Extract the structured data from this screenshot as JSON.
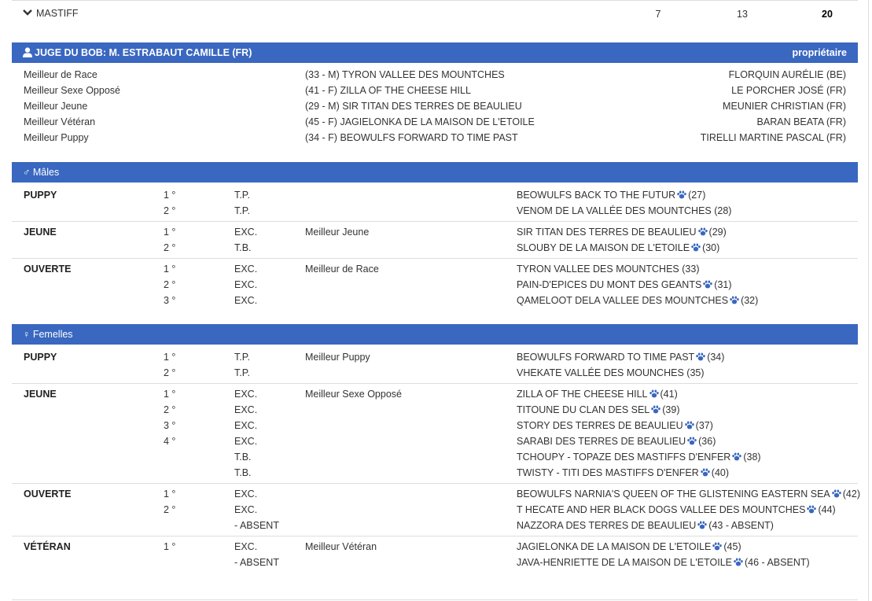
{
  "breed": {
    "name": "MASTIFF",
    "count_a": "7",
    "count_b": "13",
    "total": "20"
  },
  "judge_bar": {
    "title": "JUGE DU BOB: M. ESTRABAUT CAMILLE (FR)",
    "right": "propriétaire",
    "icon": "user-icon"
  },
  "best": [
    {
      "label": "Meilleur de Race",
      "dog": "(33 - M) TYRON VALLEE DES MOUNTCHES",
      "owner": "FLORQUIN AURÉLIE (BE)"
    },
    {
      "label": "Meilleur Sexe Opposé",
      "dog": "(41 - F) ZILLA OF THE CHEESE HILL",
      "owner": "LE PORCHER JOSÉ (FR)"
    },
    {
      "label": "Meilleur Jeune",
      "dog": "(29 - M) SIR TITAN DES TERRES DE BEAULIEU",
      "owner": "MEUNIER CHRISTIAN (FR)"
    },
    {
      "label": "Meilleur Vétéran",
      "dog": "(45 - F) JAGIELONKA DE LA MAISON DE L'ETOILE",
      "owner": "BARAN BEATA (FR)"
    },
    {
      "label": "Meilleur Puppy",
      "dog": "(34 - F) BEOWULFS FORWARD TO TIME PAST",
      "owner": "TIRELLI MARTINE PASCAL (FR)"
    }
  ],
  "males": {
    "title": "♂ Mâles",
    "groups": [
      {
        "cls": "PUPPY",
        "rows": [
          {
            "rank": "1 °",
            "qual": "T.P.",
            "award": "",
            "dog": "BEOWULFS BACK TO THE FUTUR",
            "paw": true,
            "num": "(27)"
          },
          {
            "rank": "2 °",
            "qual": "T.P.",
            "award": "",
            "dog": "VENOM DE LA VALLÉE DES MOUNTCHES",
            "paw": false,
            "num": "(28)"
          }
        ]
      },
      {
        "cls": "JEUNE",
        "rows": [
          {
            "rank": "1 °",
            "qual": "EXC.",
            "award": "Meilleur Jeune",
            "dog": "SIR TITAN DES TERRES DE BEAULIEU",
            "paw": true,
            "num": "(29)"
          },
          {
            "rank": "2 °",
            "qual": "T.B.",
            "award": "",
            "dog": "SLOUBY DE LA MAISON DE L'ETOILE",
            "paw": true,
            "num": "(30)"
          }
        ]
      },
      {
        "cls": "OUVERTE",
        "rows": [
          {
            "rank": "1 °",
            "qual": "EXC.",
            "award": "Meilleur de Race",
            "dog": "TYRON VALLEE DES MOUNTCHES",
            "paw": false,
            "num": "(33)"
          },
          {
            "rank": "2 °",
            "qual": "EXC.",
            "award": "",
            "dog": "PAIN-D'EPICES DU MONT DES GEANTS",
            "paw": true,
            "num": "(31)"
          },
          {
            "rank": "3 °",
            "qual": "EXC.",
            "award": "",
            "dog": "QAMELOOT DELA VALLEE DES MOUNTCHES",
            "paw": true,
            "num": "(32)"
          }
        ]
      }
    ]
  },
  "females": {
    "title": "♀ Femelles",
    "groups": [
      {
        "cls": "PUPPY",
        "rows": [
          {
            "rank": "1 °",
            "qual": "T.P.",
            "award": "Meilleur Puppy",
            "dog": "BEOWULFS FORWARD TO TIME PAST",
            "paw": true,
            "num": "(34)"
          },
          {
            "rank": "2 °",
            "qual": "T.P.",
            "award": "",
            "dog": "VHEKATE VALLÉE DES MOUNCHES",
            "paw": false,
            "num": "(35)"
          }
        ]
      },
      {
        "cls": "JEUNE",
        "rows": [
          {
            "rank": "1 °",
            "qual": "EXC.",
            "award": "Meilleur Sexe Opposé",
            "dog": "ZILLA OF THE CHEESE HILL",
            "paw": true,
            "num": "(41)"
          },
          {
            "rank": "2 °",
            "qual": "EXC.",
            "award": "",
            "dog": "TITOUNE DU CLAN DES SEL",
            "paw": true,
            "num": "(39)"
          },
          {
            "rank": "3 °",
            "qual": "EXC.",
            "award": "",
            "dog": "STORY DES TERRES DE BEAULIEU",
            "paw": true,
            "num": "(37)"
          },
          {
            "rank": "4 °",
            "qual": "EXC.",
            "award": "",
            "dog": "SARABI DES TERRES DE BEAULIEU",
            "paw": true,
            "num": "(36)"
          },
          {
            "rank": "",
            "qual": "T.B.",
            "award": "",
            "dog": "TCHOUPY - TOPAZE DES MASTIFFS D'ENFER",
            "paw": true,
            "num": "(38)"
          },
          {
            "rank": "",
            "qual": "T.B.",
            "award": "",
            "dog": "TWISTY - TITI DES MASTIFFS D'ENFER",
            "paw": true,
            "num": "(40)"
          }
        ]
      },
      {
        "cls": "OUVERTE",
        "rows": [
          {
            "rank": "1 °",
            "qual": "EXC.",
            "award": "",
            "dog": "BEOWULFS NARNIA'S QUEEN OF THE GLISTENING EASTERN SEA",
            "paw": true,
            "num": "(42)"
          },
          {
            "rank": "2 °",
            "qual": "EXC.",
            "award": "",
            "dog": "T HECATE AND HER BLACK DOGS VALLEE DES MOUNTCHES",
            "paw": true,
            "num": "(44)"
          },
          {
            "rank": "",
            "qual": "- ABSENT",
            "award": "",
            "dog": "NAZZORA DES TERRES DE BEAULIEU",
            "paw": true,
            "num": "(43 - ABSENT)"
          }
        ]
      },
      {
        "cls": "VÉTÉRAN",
        "rows": [
          {
            "rank": "1 °",
            "qual": "EXC.",
            "award": "Meilleur Vétéran",
            "dog": "JAGIELONKA DE LA MAISON DE L'ETOILE",
            "paw": true,
            "num": "(45)"
          },
          {
            "rank": "",
            "qual": "- ABSENT",
            "award": "",
            "dog": "JAVA-HENRIETTE DE LA MAISON DE L'ETOILE",
            "paw": true,
            "num": "(46 - ABSENT)"
          }
        ]
      }
    ]
  },
  "colors": {
    "bar": "#3a67c0",
    "paw": "#3a67c0"
  }
}
